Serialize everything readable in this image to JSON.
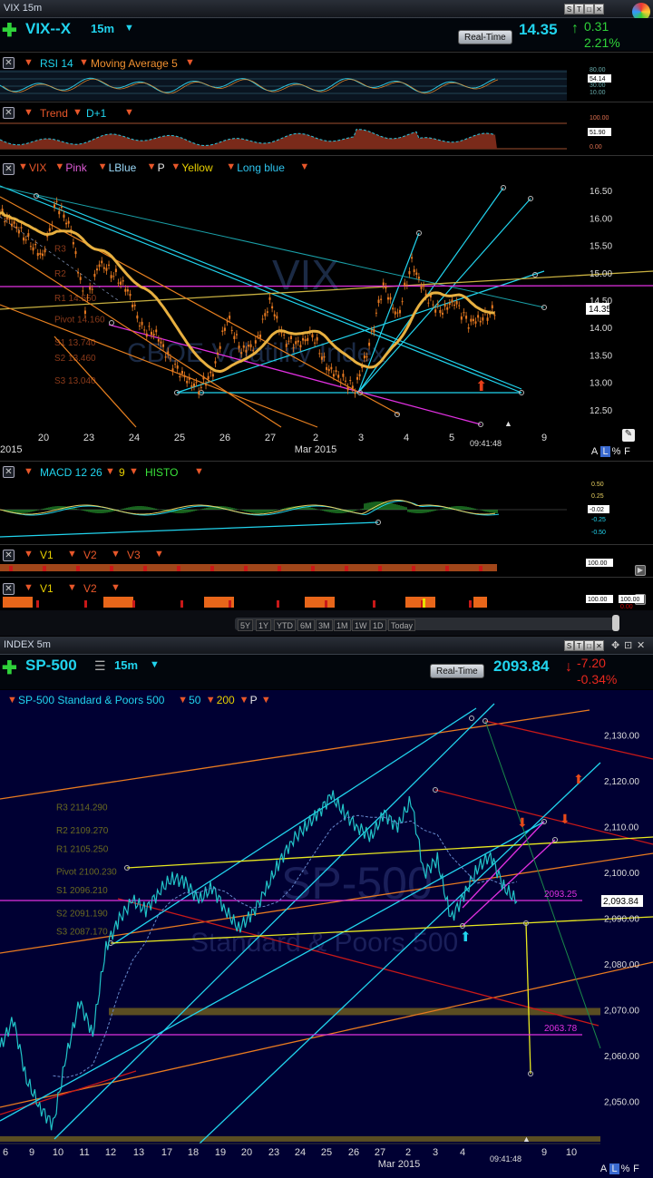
{
  "top": {
    "window_title": "VIX 15m",
    "symbol": "VIX--X",
    "interval": "15m",
    "realtime_label": "Real-Time",
    "price": "14.35",
    "change": "0.31",
    "change_pct": "2.21%",
    "toolbar_buttons": [
      "S",
      "T",
      "□",
      "✕"
    ],
    "rsi_study": {
      "label": "RSI 14",
      "ma": "Moving Average 5",
      "ticks": [
        "80.00",
        "54.14",
        "30.00",
        "10.00"
      ]
    },
    "trend_study": {
      "label": "Trend",
      "param": "D+1",
      "ticks": [
        "100.00",
        "51.90",
        "0.00"
      ]
    },
    "main_legend": [
      "VIX",
      "Pink",
      "LBlue",
      "P",
      "Yellow",
      "Long blue"
    ],
    "pivot_labels": [
      "R3",
      "R2",
      "R1 14.550",
      "Pivot 14.160",
      "S1 13.740",
      "S2 13.460",
      "S3 13.040"
    ],
    "watermark_symbol": "VIX",
    "watermark_name": "CBOE Volatility Index",
    "time_label": "09:41:48",
    "bottom_right_tools": [
      "A",
      "L",
      "%",
      "F"
    ],
    "macd_study": {
      "label": "MACD 12 26",
      "p": "9",
      "histo": "HISTO",
      "ticks": [
        "0.50",
        "0.25",
        "-0.02",
        "-0.25",
        "-0.50"
      ]
    },
    "v_study_1": {
      "labels": [
        "V1",
        "V2",
        "V3"
      ],
      "ticks": [
        "100.00"
      ]
    },
    "v_study_2": {
      "labels": [
        "V1",
        "V2"
      ],
      "ticks": [
        "100.00",
        "0.00"
      ],
      "ticks2": [
        "100.00",
        "0.00"
      ]
    },
    "range_buttons": [
      "5Y",
      "1Y",
      "YTD",
      "6M",
      "3M",
      "1M",
      "1W",
      "1D",
      "Today"
    ]
  },
  "bottom": {
    "window_title": "INDEX 5m",
    "symbol": "SP-500",
    "interval": "15m",
    "realtime_label": "Real-Time",
    "price": "2093.84",
    "change": "-7.20",
    "change_pct": "-0.34%",
    "legend": [
      "SP-500 Standard & Poors 500",
      "50",
      "200",
      "P"
    ],
    "pivot_labels": [
      "R3 2114.290",
      "R2 2109.270",
      "R1 2105.250",
      "Pivot 2100.230",
      "S1 2096.210",
      "S2 2091.190",
      "S3 2087.170"
    ],
    "level_labels": [
      "2093.25",
      "2063.78"
    ],
    "watermark_symbol": "SP-500",
    "watermark_name": "Standard & Poors 500",
    "time_label": "09:41:48",
    "bottom_right_tools": [
      "A",
      "L",
      "%",
      "F"
    ]
  },
  "chart_data": [
    {
      "type": "candlestick",
      "symbol": "VIX--X",
      "x_ticks": [
        "20",
        "23",
        "24",
        "25",
        "26",
        "27",
        "2",
        "3",
        "4",
        "5",
        "9"
      ],
      "x_period_label": "Mar 2015",
      "x_left_label": "2015",
      "y_ticks": [
        16.5,
        16.0,
        15.5,
        15.0,
        14.5,
        14.0,
        13.5,
        13.0,
        12.5
      ],
      "ylim": [
        12.2,
        16.8
      ],
      "last_value": 14.35,
      "approx_close_series": [
        16.1,
        15.9,
        15.6,
        15.3,
        16.3,
        15.8,
        14.4,
        15.2,
        15.0,
        14.7,
        14.0,
        13.9,
        13.4,
        13.1,
        12.9,
        13.2,
        14.2,
        13.6,
        13.7,
        14.5,
        13.8,
        13.7,
        13.9,
        13.3,
        13.1,
        12.9,
        13.7,
        14.8,
        14.2,
        15.2,
        14.6,
        14.3,
        14.5,
        14.1,
        14.2,
        14.35
      ]
    },
    {
      "type": "line",
      "symbol": "SP-500",
      "x_ticks": [
        "6",
        "9",
        "10",
        "11",
        "12",
        "13",
        "17",
        "18",
        "19",
        "20",
        "23",
        "24",
        "25",
        "26",
        "27",
        "2",
        "3",
        "4",
        "9",
        "10"
      ],
      "x_period_label": "Mar 2015",
      "y_ticks": [
        2130,
        2120,
        2110,
        2100,
        2090,
        2080,
        2070,
        2060,
        2050
      ],
      "ylim": [
        2041,
        2136
      ],
      "last_value": 2093.84,
      "approx_series": [
        2062,
        2068,
        2055,
        2049,
        2045,
        2060,
        2072,
        2065,
        2084,
        2090,
        2094,
        2092,
        2096,
        2099,
        2098,
        2094,
        2097,
        2092,
        2088,
        2091,
        2096,
        2102,
        2107,
        2110,
        2113,
        2117,
        2113,
        2110,
        2108,
        2113,
        2110,
        2116,
        2100,
        2103,
        2090,
        2095,
        2101,
        2104,
        2097,
        2093.84
      ]
    }
  ]
}
